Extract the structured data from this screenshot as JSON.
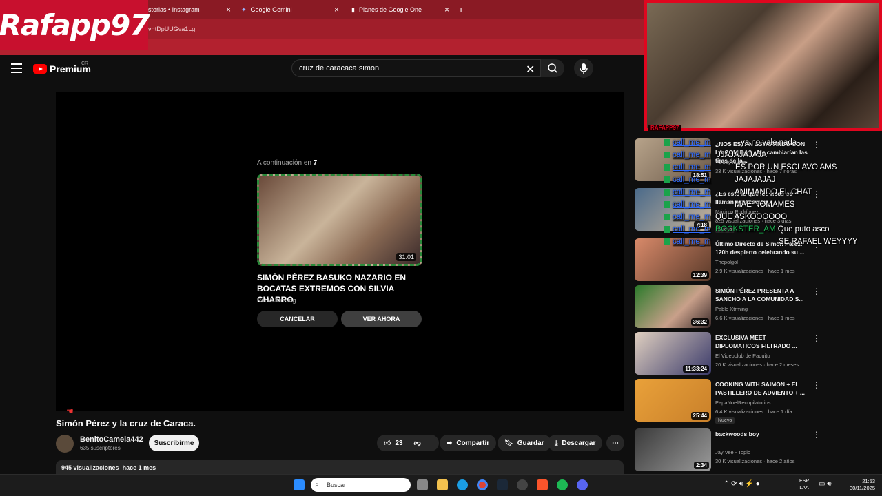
{
  "browser": {
    "tabs": [
      {
        "label": "storias • Instagram"
      },
      {
        "label": "Google Gemini"
      },
      {
        "label": "Planes de Google One"
      }
    ],
    "url_fragment": "v=tDpUUGva1Lg",
    "overlay_logo": "Rafapp97"
  },
  "youtube": {
    "logo_text": "Premium",
    "region": "CR",
    "search_query": "cruz de caracaca simon"
  },
  "player": {
    "upnext_prefix": "A continuación en",
    "upnext_count": "7",
    "upnext_title": "SIMÓN PÉREZ BASUKO NAZARIO EN BOCATAS EXTREMOS CON SILVIA CHARRO",
    "upnext_channel": "Pablo Xtrming",
    "upnext_duration": "31:01",
    "cancel_label": "CANCELAR",
    "play_now_label": "VER AHORA"
  },
  "video": {
    "title": "Simón Pérez y la cruz de Caraca.",
    "channel": "BenitoCamela442",
    "subscribers": "635 suscriptores",
    "subscribe_label": "Suscribirme",
    "likes": "23",
    "share_label": "Compartir",
    "save_label": "Guardar",
    "download_label": "Descargar",
    "views": "945 visualizaciones",
    "age": "hace 1 mes"
  },
  "sidebar": [
    {
      "title": "¿NOS ESTÁN ESTAFANDO CON LA COMIDA? ¿Me cambiarían las tiras de la...",
      "channel": "Yo soy Migue",
      "meta": "33 K visualizaciones · hace 7 horas",
      "duration": "18:51"
    },
    {
      "title": "¿Es esto lo que los ricos os llaman explicación...",
      "channel": "Máximo Rodríguez",
      "meta": "825 visualizaciones · hace 3 días",
      "duration": "7:18",
      "badge": "Nuevo"
    },
    {
      "title": "Último Directo de Simón Pérez: 120h despierto celebrando su ...",
      "channel": "Thepolgol",
      "meta": "2,9 K visualizaciones · hace 1 mes",
      "duration": "12:39"
    },
    {
      "title": "SIMÓN PÉREZ PRESENTA A SANCHO A LA COMUNIDAD S...",
      "channel": "Pablo Xtrming",
      "meta": "6,6 K visualizaciones · hace 1 mes",
      "duration": "36:32"
    },
    {
      "title": "EXCLUSIVA MEET DIPLOMATICOS FILTRADO ...",
      "channel": "El Videoclub de Paquito",
      "meta": "20 K visualizaciones · hace 2 meses",
      "duration": "11:33:24"
    },
    {
      "title": "COOKING WITH SAIMON + EL PASTILLERO DE ADVIENTO + ...",
      "channel": "PapaNoelRecopilatorios",
      "meta": "6,4 K visualizaciones · hace 1 día",
      "duration": "25:44",
      "badge": "Nuevo"
    },
    {
      "title": "backwoods boy",
      "channel": "Jay Vee - Topic",
      "meta": "30 K visualizaciones · hace 2 años",
      "duration": "2:34"
    }
  ],
  "chat": [
    {
      "user": "",
      "text": "ya no vale nada"
    },
    {
      "user": "",
      "text": "JJAJAJAJAJA"
    },
    {
      "user": "",
      "text": "ES POR UN ESCLAVO AMS"
    },
    {
      "user": "",
      "text": "JAJAJAJAJ"
    },
    {
      "user": "",
      "text": "ANIMANDO EL CHAT"
    },
    {
      "user": "",
      "text": "MAE NOMAMES"
    },
    {
      "user": "",
      "text": "QUE ASKOOOOOO"
    },
    {
      "user": "ROCKSTER_AM",
      "text": "Que puto asco"
    },
    {
      "user": "",
      "text": "SE RAFAEL WEYYYY"
    }
  ],
  "chat_user": "call_me_m",
  "webcam_label": "RAFAPP97",
  "taskbar": {
    "search_placeholder": "Buscar",
    "lang": "ESP",
    "lang2": "LAA",
    "time": "21:53",
    "date": "30/11/2025"
  },
  "colors": {
    "accent": "#ff0000",
    "brand": "#c8102e"
  }
}
